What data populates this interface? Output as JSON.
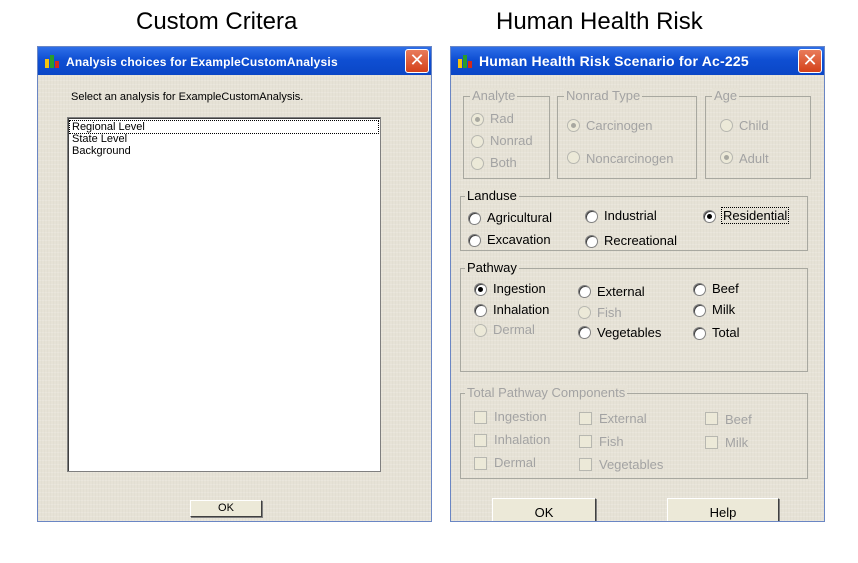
{
  "captions": {
    "left": "Custom Critera",
    "right": "Human Health Risk"
  },
  "colors": {
    "titlebar": "#0f4fd3",
    "dialog_bg": "#ece9d8",
    "close": "#d4411a"
  },
  "custom_dialog": {
    "title": "Analysis choices for ExampleCustomAnalysis",
    "prompt": "Select an analysis for ExampleCustomAnalysis.",
    "items": [
      "Regional Level",
      "State Level",
      "Background"
    ],
    "selected_item": "Regional Level",
    "ok_label": "OK",
    "close_glyph": "✕"
  },
  "hhr_dialog": {
    "title": "Human Health Risk Scenario for Ac-225",
    "close_glyph": "✕",
    "analyte": {
      "label": "Analyte",
      "options": [
        "Rad",
        "Nonrad",
        "Both"
      ],
      "selected": "Rad",
      "enabled": false
    },
    "nonrad_type": {
      "label": "Nonrad Type",
      "options": [
        "Carcinogen",
        "Noncarcinogen"
      ],
      "selected": "Carcinogen",
      "enabled": false
    },
    "age": {
      "label": "Age",
      "options": [
        "Child",
        "Adult"
      ],
      "selected": "Adult",
      "enabled": false
    },
    "landuse": {
      "label": "Landuse",
      "options": [
        "Agricultural",
        "Industrial",
        "Residential",
        "Excavation",
        "Recreational"
      ],
      "selected": "Residential"
    },
    "pathway": {
      "label": "Pathway",
      "options": [
        "Ingestion",
        "External",
        "Beef",
        "Inhalation",
        "Fish",
        "Milk",
        "Dermal",
        "Vegetables",
        "Total"
      ],
      "selected": "Ingestion",
      "disabled": [
        "Fish",
        "Dermal"
      ]
    },
    "components": {
      "label": "Total Pathway Components",
      "options": [
        "Ingestion",
        "External",
        "Beef",
        "Inhalation",
        "Fish",
        "Milk",
        "Dermal",
        "Vegetables"
      ],
      "enabled": false
    },
    "ok_label": "OK",
    "help_label": "Help"
  }
}
